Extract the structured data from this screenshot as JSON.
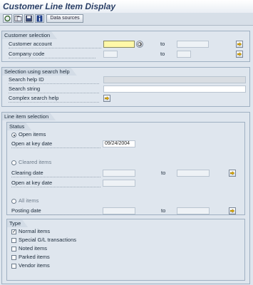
{
  "window": {
    "title": "Customer Line Item Display"
  },
  "toolbar": {
    "icons": [
      "execute-icon",
      "get-variant-icon",
      "save-variant-icon",
      "info-icon"
    ],
    "data_sources_label": "Data sources"
  },
  "customer_selection": {
    "title": "Customer selection",
    "customer_account_label": "Customer account",
    "customer_account_value": "",
    "company_code_label": "Company code",
    "company_code_value": "",
    "to_label": "to"
  },
  "search_help": {
    "title": "Selection using search help",
    "search_help_id_label": "Search help ID",
    "search_string_label": "Search string",
    "complex_search_help_label": "Complex search help"
  },
  "line_item_selection": {
    "title": "Line item selection",
    "status": {
      "title": "Status",
      "open_items_label": "Open items",
      "open_at_key_date_label": "Open at key date",
      "open_at_key_date_value": "09/24/2004",
      "cleared_items_label": "Cleared items",
      "clearing_date_label": "Clearing date",
      "open_at_key_date2_label": "Open at key date",
      "all_items_label": "All items",
      "posting_date_label": "Posting date",
      "to_label": "to"
    },
    "type": {
      "title": "Type",
      "items": [
        {
          "label": "Normal items",
          "checked": true
        },
        {
          "label": "Special G/L transactions",
          "checked": false
        },
        {
          "label": "Noted items",
          "checked": false
        },
        {
          "label": "Parked items",
          "checked": false
        },
        {
          "label": "Vendor items",
          "checked": false
        }
      ]
    }
  },
  "colors": {
    "title": "#2a3f66",
    "background": "#dfe6ee",
    "active_field": "#fff8a8"
  }
}
